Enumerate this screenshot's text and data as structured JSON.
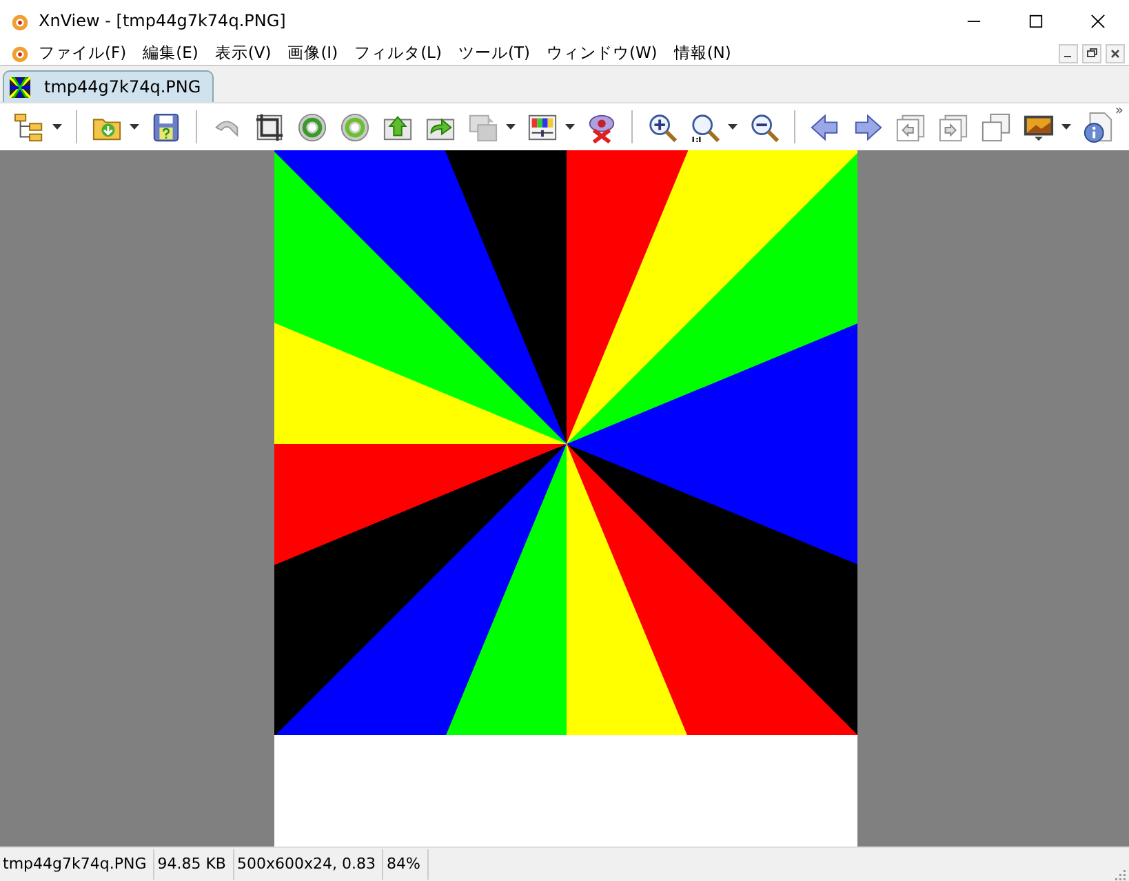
{
  "window": {
    "title": "XnView - [tmp44g7k74q.PNG]"
  },
  "menu": [
    "ファイル(F)",
    "編集(E)",
    "表示(V)",
    "画像(I)",
    "フィルタ(L)",
    "ツール(T)",
    "ウィンドウ(W)",
    "情報(N)"
  ],
  "tabs": [
    {
      "label": "tmp44g7k74q.PNG",
      "selected": true
    }
  ],
  "toolbar": {
    "overflow": "»"
  },
  "status_bar": [
    "tmp44g7k74q.PNG",
    "94.85 KB",
    "500x600x24, 0.83",
    "84%"
  ]
}
